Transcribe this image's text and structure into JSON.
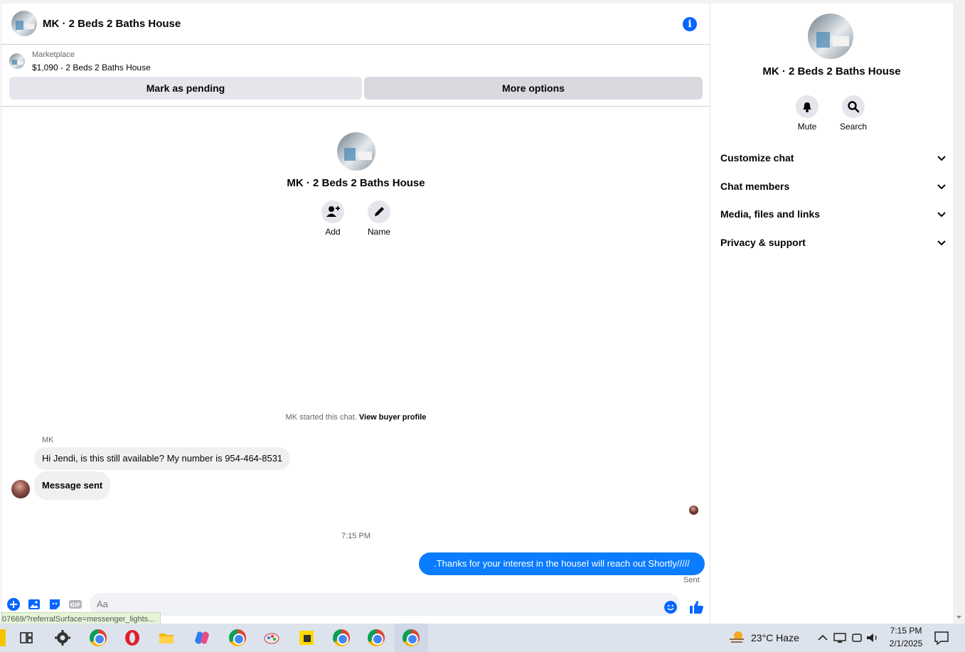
{
  "header": {
    "title": "MK · 2 Beds 2 Baths House"
  },
  "marketplace": {
    "label": "Marketplace",
    "listing": "$1,090 - 2 Beds 2 Baths House",
    "pending_button": "Mark as pending",
    "more_button": "More options"
  },
  "intro": {
    "title": "MK · 2 Beds 2 Baths House",
    "add_label": "Add",
    "name_label": "Name"
  },
  "messages": {
    "system_text": "MK started this chat.",
    "system_link": "View buyer profile",
    "sender": "MK",
    "incoming": [
      "Hi Jendi, is this still available? My number is 954-464-8531",
      "Message sent"
    ],
    "timestamp": "7:15 PM",
    "outgoing": ".Thanks for your interest in the houseI will reach out Shortly/////",
    "sent_status": "Sent"
  },
  "composer": {
    "placeholder": "Aa",
    "status_url": "07669/?referralSurface=messenger_lights..."
  },
  "details_panel": {
    "title": "MK · 2 Beds 2 Baths House",
    "mute_label": "Mute",
    "search_label": "Search",
    "sections": [
      "Customize chat",
      "Chat members",
      "Media, files and links",
      "Privacy & support"
    ]
  },
  "taskbar": {
    "weather": "23°C  Haze",
    "time": "7:15 PM",
    "date": "2/1/2025"
  },
  "colors": {
    "accent": "#0866ff",
    "outgoing_bubble": "#0a7cff",
    "incoming_bubble": "#f0f0f0"
  },
  "icons": [
    "info-icon",
    "add-person-icon",
    "pencil-icon",
    "bell-icon",
    "search-icon",
    "chevron-down-icon",
    "plus-icon",
    "image-icon",
    "sticker-icon",
    "gif-icon",
    "emoji-icon",
    "thumbs-up-icon"
  ]
}
